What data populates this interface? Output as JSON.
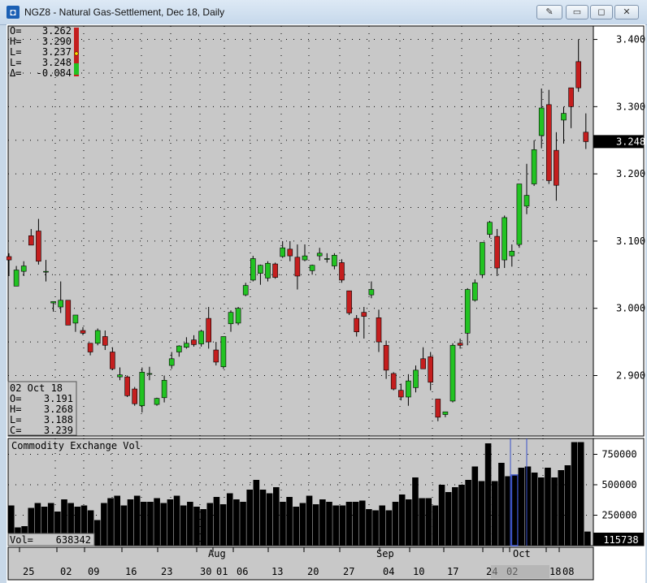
{
  "window": {
    "title": "NGZ8 - Natural Gas-Settlement, Dec 18, Daily",
    "icon": "app-icon",
    "buttons": [
      "pin-icon",
      "minimize-icon",
      "restore-icon",
      "close-icon"
    ]
  },
  "ohlc_summary": {
    "labels": [
      "O=",
      "H=",
      "L=",
      "L=",
      "Δ="
    ],
    "values": [
      "3.262",
      "3.290",
      "3.237",
      "3.248",
      "-0.084"
    ]
  },
  "cursor_box": {
    "date": "02 Oct 18",
    "labels": [
      "O=",
      "H=",
      "L=",
      "C="
    ],
    "values": [
      "3.191",
      "3.268",
      "3.188",
      "3.239"
    ]
  },
  "last_price_label": "3.248",
  "volume_panel": {
    "title": "Commodity Exchange Vol",
    "vol_label": "Vol=",
    "vol_value": "638342",
    "last_volume_label": "115738"
  },
  "colors": {
    "up": "#22c322",
    "down": "#c41e1e",
    "background": "#c8c8c8",
    "bar": "#000000",
    "highlight": "#3a52c8"
  },
  "chart_data": [
    {
      "type": "candlestick",
      "title": "NGZ8 - Natural Gas-Settlement, Dec 18, Daily",
      "y_ticks": [
        2.9,
        3.0,
        3.1,
        3.2,
        3.3,
        3.4
      ],
      "y_tick_labels": [
        "2.900",
        "3.000",
        "3.100",
        "3.200",
        "3.300",
        "3.400"
      ],
      "ylim": [
        2.81,
        3.42
      ],
      "x_tick_labels": [
        "25",
        "02",
        "09",
        "16",
        "23",
        "30",
        "01",
        "06",
        "13",
        "20",
        "27",
        "04",
        "10",
        "17",
        "24",
        "02",
        "Oct",
        "18",
        "08"
      ],
      "month_labels": [
        "Aug",
        "Sep"
      ],
      "candles": [
        {
          "o": 3.077,
          "h": 3.082,
          "l": 3.048,
          "c": 3.072
        },
        {
          "o": 3.033,
          "h": 3.063,
          "l": 3.033,
          "c": 3.057
        },
        {
          "o": 3.055,
          "h": 3.07,
          "l": 3.048,
          "c": 3.063
        },
        {
          "o": 3.108,
          "h": 3.118,
          "l": 3.103,
          "c": 3.094
        },
        {
          "o": 3.115,
          "h": 3.133,
          "l": 3.065,
          "c": 3.07
        },
        {
          "o": 3.055,
          "h": 3.072,
          "l": 3.04,
          "c": 3.055
        },
        {
          "o": 3.008,
          "h": 3.01,
          "l": 2.995,
          "c": 3.01
        },
        {
          "o": 3.002,
          "h": 3.04,
          "l": 2.993,
          "c": 3.012
        },
        {
          "o": 3.012,
          "h": 3.012,
          "l": 2.975,
          "c": 2.975
        },
        {
          "o": 2.978,
          "h": 2.99,
          "l": 2.965,
          "c": 2.99
        },
        {
          "o": 2.967,
          "h": 2.972,
          "l": 2.96,
          "c": 2.963
        },
        {
          "o": 2.948,
          "h": 2.948,
          "l": 2.93,
          "c": 2.935
        },
        {
          "o": 2.948,
          "h": 2.97,
          "l": 2.945,
          "c": 2.967
        },
        {
          "o": 2.958,
          "h": 2.967,
          "l": 2.938,
          "c": 2.945
        },
        {
          "o": 2.935,
          "h": 2.942,
          "l": 2.908,
          "c": 2.91
        },
        {
          "o": 2.898,
          "h": 2.912,
          "l": 2.893,
          "c": 2.901
        },
        {
          "o": 2.898,
          "h": 2.9,
          "l": 2.868,
          "c": 2.87
        },
        {
          "o": 2.88,
          "h": 2.883,
          "l": 2.855,
          "c": 2.858
        },
        {
          "o": 2.855,
          "h": 2.912,
          "l": 2.845,
          "c": 2.905
        },
        {
          "o": 2.903,
          "h": 2.913,
          "l": 2.893,
          "c": 2.903
        },
        {
          "o": 2.857,
          "h": 2.867,
          "l": 2.855,
          "c": 2.866
        },
        {
          "o": 2.867,
          "h": 2.9,
          "l": 2.86,
          "c": 2.893
        },
        {
          "o": 2.915,
          "h": 2.935,
          "l": 2.91,
          "c": 2.925
        },
        {
          "o": 2.935,
          "h": 2.945,
          "l": 2.928,
          "c": 2.944
        },
        {
          "o": 2.942,
          "h": 2.957,
          "l": 2.94,
          "c": 2.948
        },
        {
          "o": 2.953,
          "h": 2.96,
          "l": 2.943,
          "c": 2.946
        },
        {
          "o": 2.947,
          "h": 2.968,
          "l": 2.943,
          "c": 2.966
        },
        {
          "o": 2.985,
          "h": 3.002,
          "l": 2.94,
          "c": 2.95
        },
        {
          "o": 2.938,
          "h": 2.95,
          "l": 2.915,
          "c": 2.92
        },
        {
          "o": 2.913,
          "h": 2.958,
          "l": 2.91,
          "c": 2.958
        },
        {
          "o": 2.977,
          "h": 2.997,
          "l": 2.965,
          "c": 2.994
        },
        {
          "o": 2.978,
          "h": 3.002,
          "l": 2.975,
          "c": 3.0
        },
        {
          "o": 3.02,
          "h": 3.038,
          "l": 3.018,
          "c": 3.034
        },
        {
          "o": 3.042,
          "h": 3.078,
          "l": 3.04,
          "c": 3.074
        },
        {
          "o": 3.052,
          "h": 3.065,
          "l": 3.035,
          "c": 3.064
        },
        {
          "o": 3.045,
          "h": 3.07,
          "l": 3.04,
          "c": 3.067
        },
        {
          "o": 3.066,
          "h": 3.068,
          "l": 3.044,
          "c": 3.046
        },
        {
          "o": 3.077,
          "h": 3.1,
          "l": 3.075,
          "c": 3.09
        },
        {
          "o": 3.088,
          "h": 3.1,
          "l": 3.07,
          "c": 3.078
        },
        {
          "o": 3.076,
          "h": 3.095,
          "l": 3.028,
          "c": 3.048
        },
        {
          "o": 3.072,
          "h": 3.095,
          "l": 3.07,
          "c": 3.078
        },
        {
          "o": 3.056,
          "h": 3.065,
          "l": 3.05,
          "c": 3.064
        },
        {
          "o": 3.078,
          "h": 3.09,
          "l": 3.071,
          "c": 3.082
        },
        {
          "o": 3.074,
          "h": 3.082,
          "l": 3.068,
          "c": 3.074
        },
        {
          "o": 3.063,
          "h": 3.082,
          "l": 3.058,
          "c": 3.079
        },
        {
          "o": 3.068,
          "h": 3.073,
          "l": 3.038,
          "c": 3.042
        },
        {
          "o": 3.026,
          "h": 3.026,
          "l": 2.99,
          "c": 2.993
        },
        {
          "o": 2.985,
          "h": 2.99,
          "l": 2.958,
          "c": 2.965
        },
        {
          "o": 2.994,
          "h": 3.002,
          "l": 2.955,
          "c": 2.988
        },
        {
          "o": 3.02,
          "h": 3.04,
          "l": 3.015,
          "c": 3.028
        },
        {
          "o": 2.986,
          "h": 2.998,
          "l": 2.935,
          "c": 2.95
        },
        {
          "o": 2.945,
          "h": 2.952,
          "l": 2.895,
          "c": 2.908
        },
        {
          "o": 2.903,
          "h": 2.905,
          "l": 2.878,
          "c": 2.88
        },
        {
          "o": 2.878,
          "h": 2.888,
          "l": 2.863,
          "c": 2.868
        },
        {
          "o": 2.868,
          "h": 2.902,
          "l": 2.855,
          "c": 2.892
        },
        {
          "o": 2.882,
          "h": 2.915,
          "l": 2.875,
          "c": 2.908
        },
        {
          "o": 2.925,
          "h": 2.942,
          "l": 2.91,
          "c": 2.91
        },
        {
          "o": 2.928,
          "h": 2.935,
          "l": 2.878,
          "c": 2.89
        },
        {
          "o": 2.865,
          "h": 2.865,
          "l": 2.832,
          "c": 2.838
        },
        {
          "o": 2.842,
          "h": 2.846,
          "l": 2.838,
          "c": 2.846
        },
        {
          "o": 2.862,
          "h": 2.948,
          "l": 2.86,
          "c": 2.945
        },
        {
          "o": 2.948,
          "h": 2.955,
          "l": 2.94,
          "c": 2.945
        },
        {
          "o": 2.963,
          "h": 3.03,
          "l": 2.945,
          "c": 3.028
        },
        {
          "o": 3.012,
          "h": 3.043,
          "l": 3.01,
          "c": 3.038
        },
        {
          "o": 3.05,
          "h": 3.098,
          "l": 3.045,
          "c": 3.098
        },
        {
          "o": 3.11,
          "h": 3.13,
          "l": 3.105,
          "c": 3.128
        },
        {
          "o": 3.107,
          "h": 3.118,
          "l": 3.048,
          "c": 3.06
        },
        {
          "o": 3.072,
          "h": 3.138,
          "l": 3.06,
          "c": 3.135
        },
        {
          "o": 3.078,
          "h": 3.095,
          "l": 3.062,
          "c": 3.085
        },
        {
          "o": 3.095,
          "h": 3.185,
          "l": 3.09,
          "c": 3.185
        },
        {
          "o": 3.152,
          "h": 3.215,
          "l": 3.14,
          "c": 3.168
        },
        {
          "o": 3.185,
          "h": 3.25,
          "l": 3.182,
          "c": 3.236
        },
        {
          "o": 3.257,
          "h": 3.327,
          "l": 3.238,
          "c": 3.298
        },
        {
          "o": 3.303,
          "h": 3.325,
          "l": 3.185,
          "c": 3.19
        },
        {
          "o": 3.235,
          "h": 3.262,
          "l": 3.16,
          "c": 3.183
        },
        {
          "o": 3.28,
          "h": 3.3,
          "l": 3.245,
          "c": 3.29
        },
        {
          "o": 3.328,
          "h": 3.328,
          "l": 3.268,
          "c": 3.3
        },
        {
          "o": 3.367,
          "h": 3.4,
          "l": 3.322,
          "c": 3.328
        },
        {
          "o": 3.262,
          "h": 3.29,
          "l": 3.237,
          "c": 3.248
        }
      ]
    },
    {
      "type": "bar",
      "title": "Commodity Exchange Vol",
      "y_ticks": [
        250000,
        500000,
        750000
      ],
      "y_tick_labels": [
        "250000",
        "500000",
        "750000"
      ],
      "ylim": [
        0,
        880000
      ],
      "values": [
        330000,
        150000,
        160000,
        310000,
        350000,
        320000,
        350000,
        280000,
        380000,
        350000,
        320000,
        330000,
        290000,
        210000,
        350000,
        390000,
        410000,
        330000,
        380000,
        410000,
        360000,
        360000,
        390000,
        350000,
        380000,
        410000,
        330000,
        360000,
        320000,
        300000,
        350000,
        400000,
        340000,
        430000,
        380000,
        360000,
        460000,
        540000,
        460000,
        430000,
        480000,
        360000,
        400000,
        320000,
        350000,
        410000,
        340000,
        380000,
        360000,
        330000,
        330000,
        360000,
        360000,
        370000,
        300000,
        290000,
        330000,
        290000,
        360000,
        420000,
        380000,
        560000,
        390000,
        390000,
        330000,
        500000,
        440000,
        480000,
        500000,
        540000,
        650000,
        530000,
        840000,
        530000,
        680000,
        570000,
        580000,
        640000,
        650000,
        600000,
        560000,
        640000,
        560000,
        620000,
        660000,
        850000,
        850000,
        115738
      ]
    }
  ]
}
